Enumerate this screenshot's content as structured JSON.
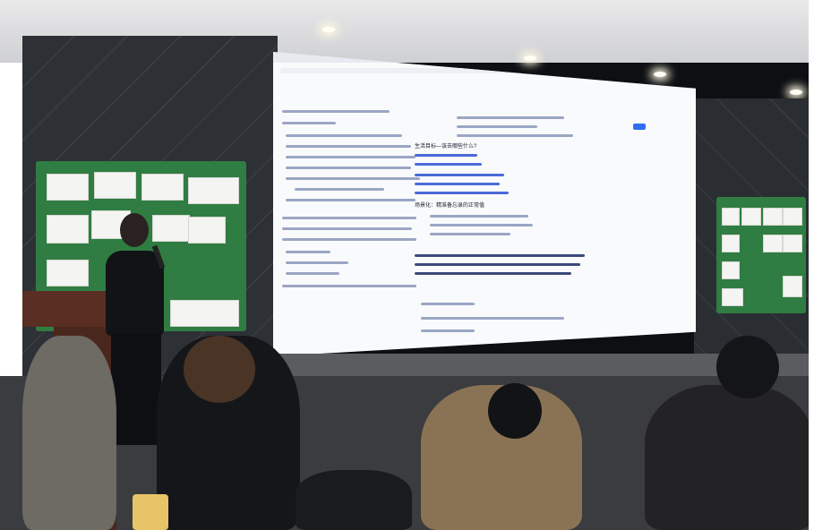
{
  "scene": {
    "description_hidden": false
  },
  "screen": {
    "section1_title": "生活目标—该去哪些什么?",
    "section2_title": "场景化：精准备忘录的正常值",
    "btn_label": ""
  },
  "colors": {
    "board": "#2f7d42",
    "screen_glow": "#bfc8ff",
    "accent": "#2e6ef2"
  }
}
